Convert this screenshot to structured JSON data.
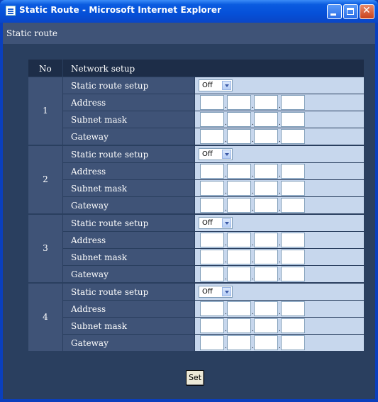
{
  "window": {
    "title": "Static Route - Microsoft Internet Explorer"
  },
  "page": {
    "section_title": "Static route"
  },
  "table": {
    "header_no": "No",
    "header_network": "Network setup",
    "rows": [
      {
        "no": "1",
        "labels": [
          "Static route setup",
          "Address",
          "Subnet mask",
          "Gateway"
        ],
        "setup_value": "Off"
      },
      {
        "no": "2",
        "labels": [
          "Static route setup",
          "Address",
          "Subnet mask",
          "Gateway"
        ],
        "setup_value": "Off"
      },
      {
        "no": "3",
        "labels": [
          "Static route setup",
          "Address",
          "Subnet mask",
          "Gateway"
        ],
        "setup_value": "Off"
      },
      {
        "no": "4",
        "labels": [
          "Static route setup",
          "Address",
          "Subnet mask",
          "Gateway"
        ],
        "setup_value": "Off"
      }
    ],
    "ip_separator": "."
  },
  "buttons": {
    "set_label": "Set"
  }
}
